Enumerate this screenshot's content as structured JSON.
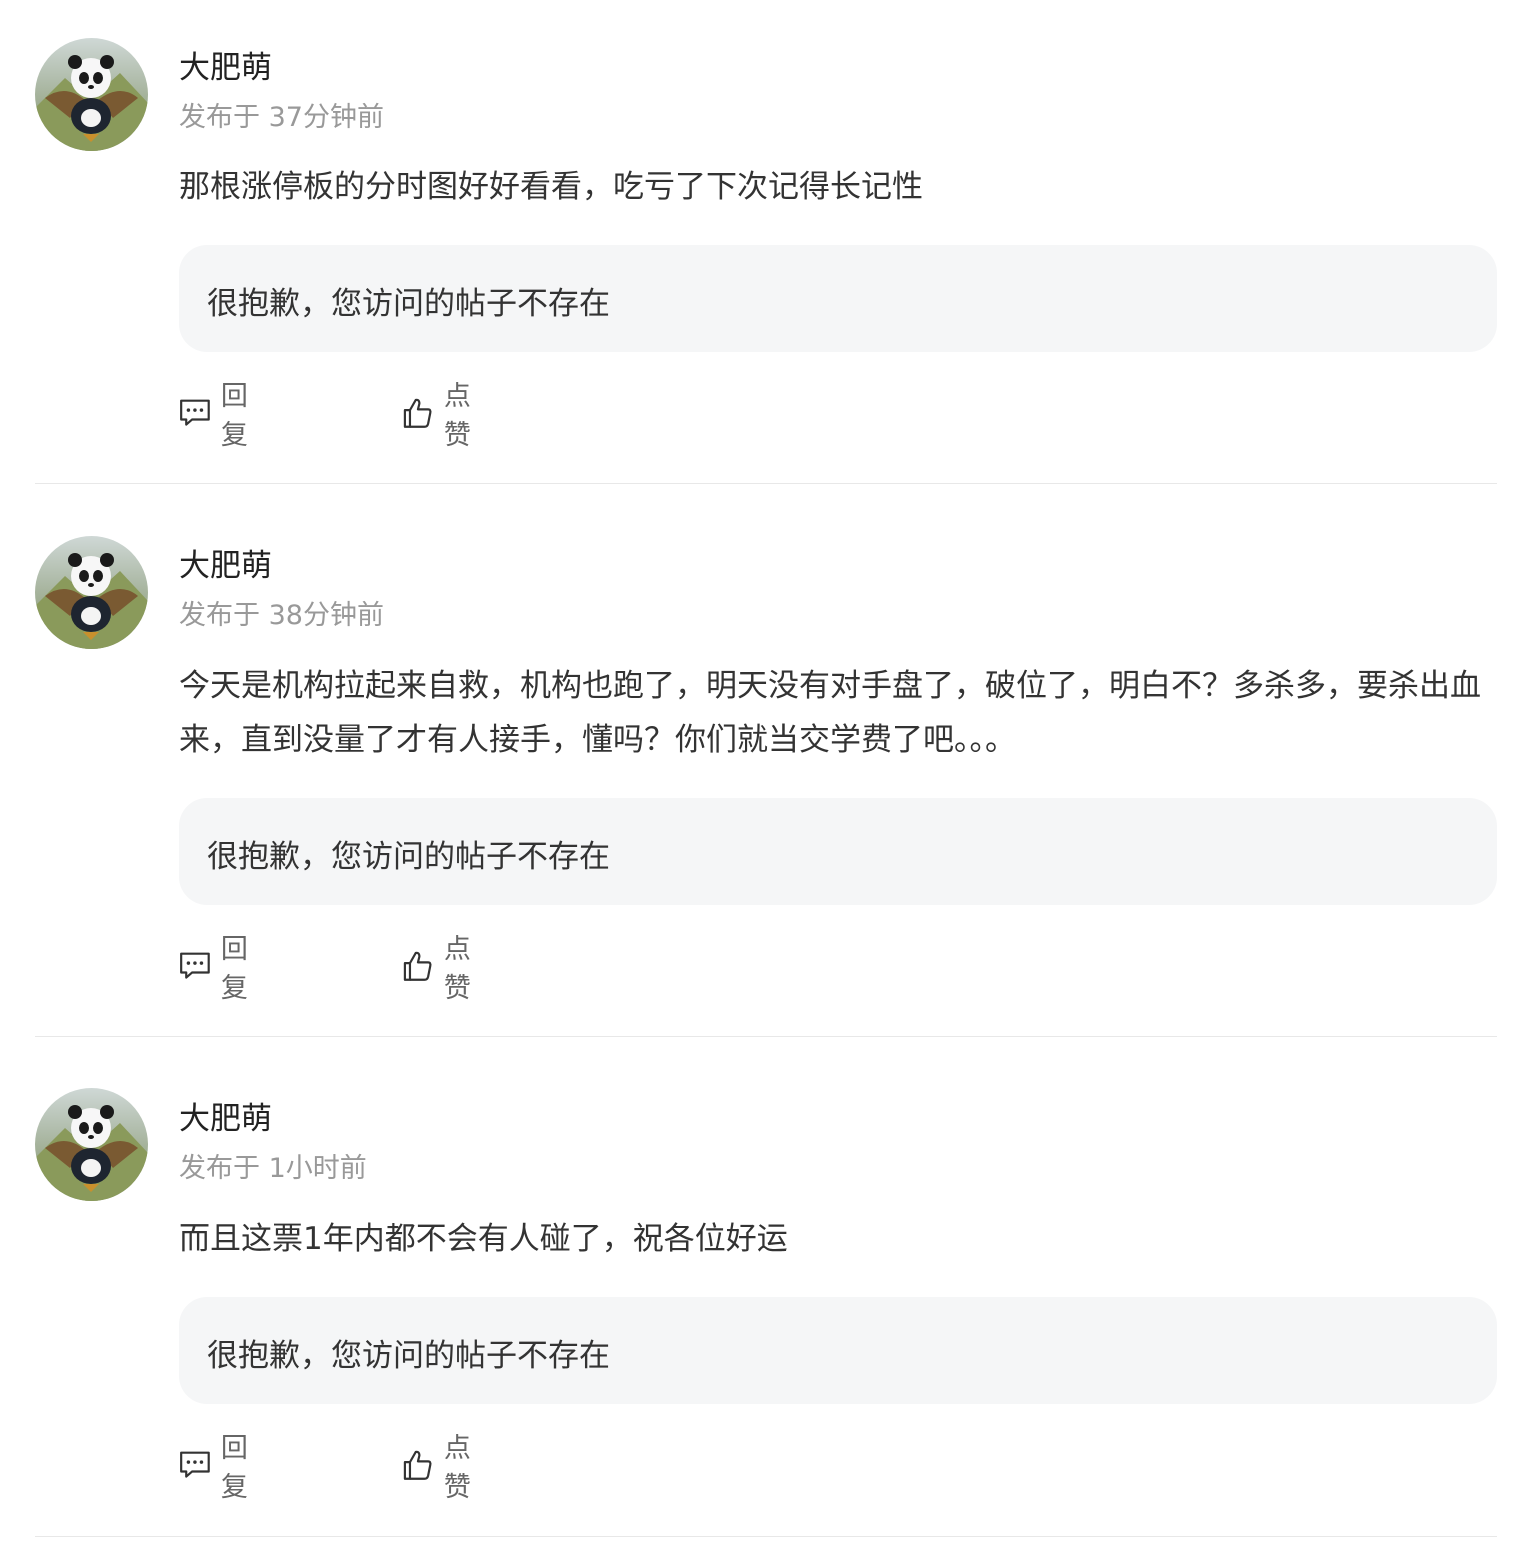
{
  "posts": [
    {
      "username": "大肥萌",
      "timestamp": "发布于 37分钟前",
      "content": "那根涨停板的分时图好好看看，吃亏了下次记得长记性",
      "quote": "很抱歉，您访问的帖子不存在",
      "reply_label": "回复",
      "like_label": "点赞"
    },
    {
      "username": "大肥萌",
      "timestamp": "发布于 38分钟前",
      "content": "今天是机构拉起来自救，机构也跑了，明天没有对手盘了，破位了，明白不？多杀多，要杀出血来，直到没量了才有人接手，懂吗？你们就当交学费了吧。。。",
      "quote": "很抱歉，您访问的帖子不存在",
      "reply_label": "回复",
      "like_label": "点赞"
    },
    {
      "username": "大肥萌",
      "timestamp": "发布于 1小时前",
      "content": "而且这票1年内都不会有人碰了，祝各位好运",
      "quote": "很抱歉，您访问的帖子不存在",
      "reply_label": "回复",
      "like_label": "点赞"
    }
  ],
  "icons": {
    "reply": "comment-icon",
    "like": "thumbs-up-icon",
    "avatar": "panda-avatar"
  },
  "colors": {
    "quote_bg": "#f5f6f7",
    "meta_text": "#999999",
    "icon_stroke": "#333333"
  }
}
